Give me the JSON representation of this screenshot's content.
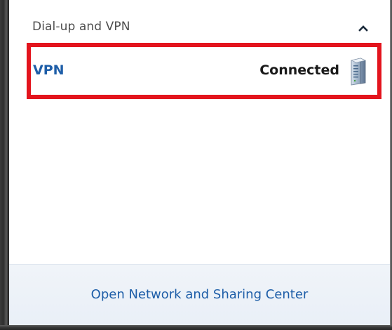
{
  "section": {
    "title": "Dial-up and VPN",
    "collapse_icon": "chevron-up-icon"
  },
  "connection": {
    "name": "VPN",
    "status": "Connected",
    "icon": "vpn-server-icon",
    "highlight_color": "#e3141d"
  },
  "footer": {
    "link_label": "Open Network and Sharing Center"
  },
  "colors": {
    "link_blue": "#1e5ea8",
    "footer_bg": "#eaf0f7"
  }
}
